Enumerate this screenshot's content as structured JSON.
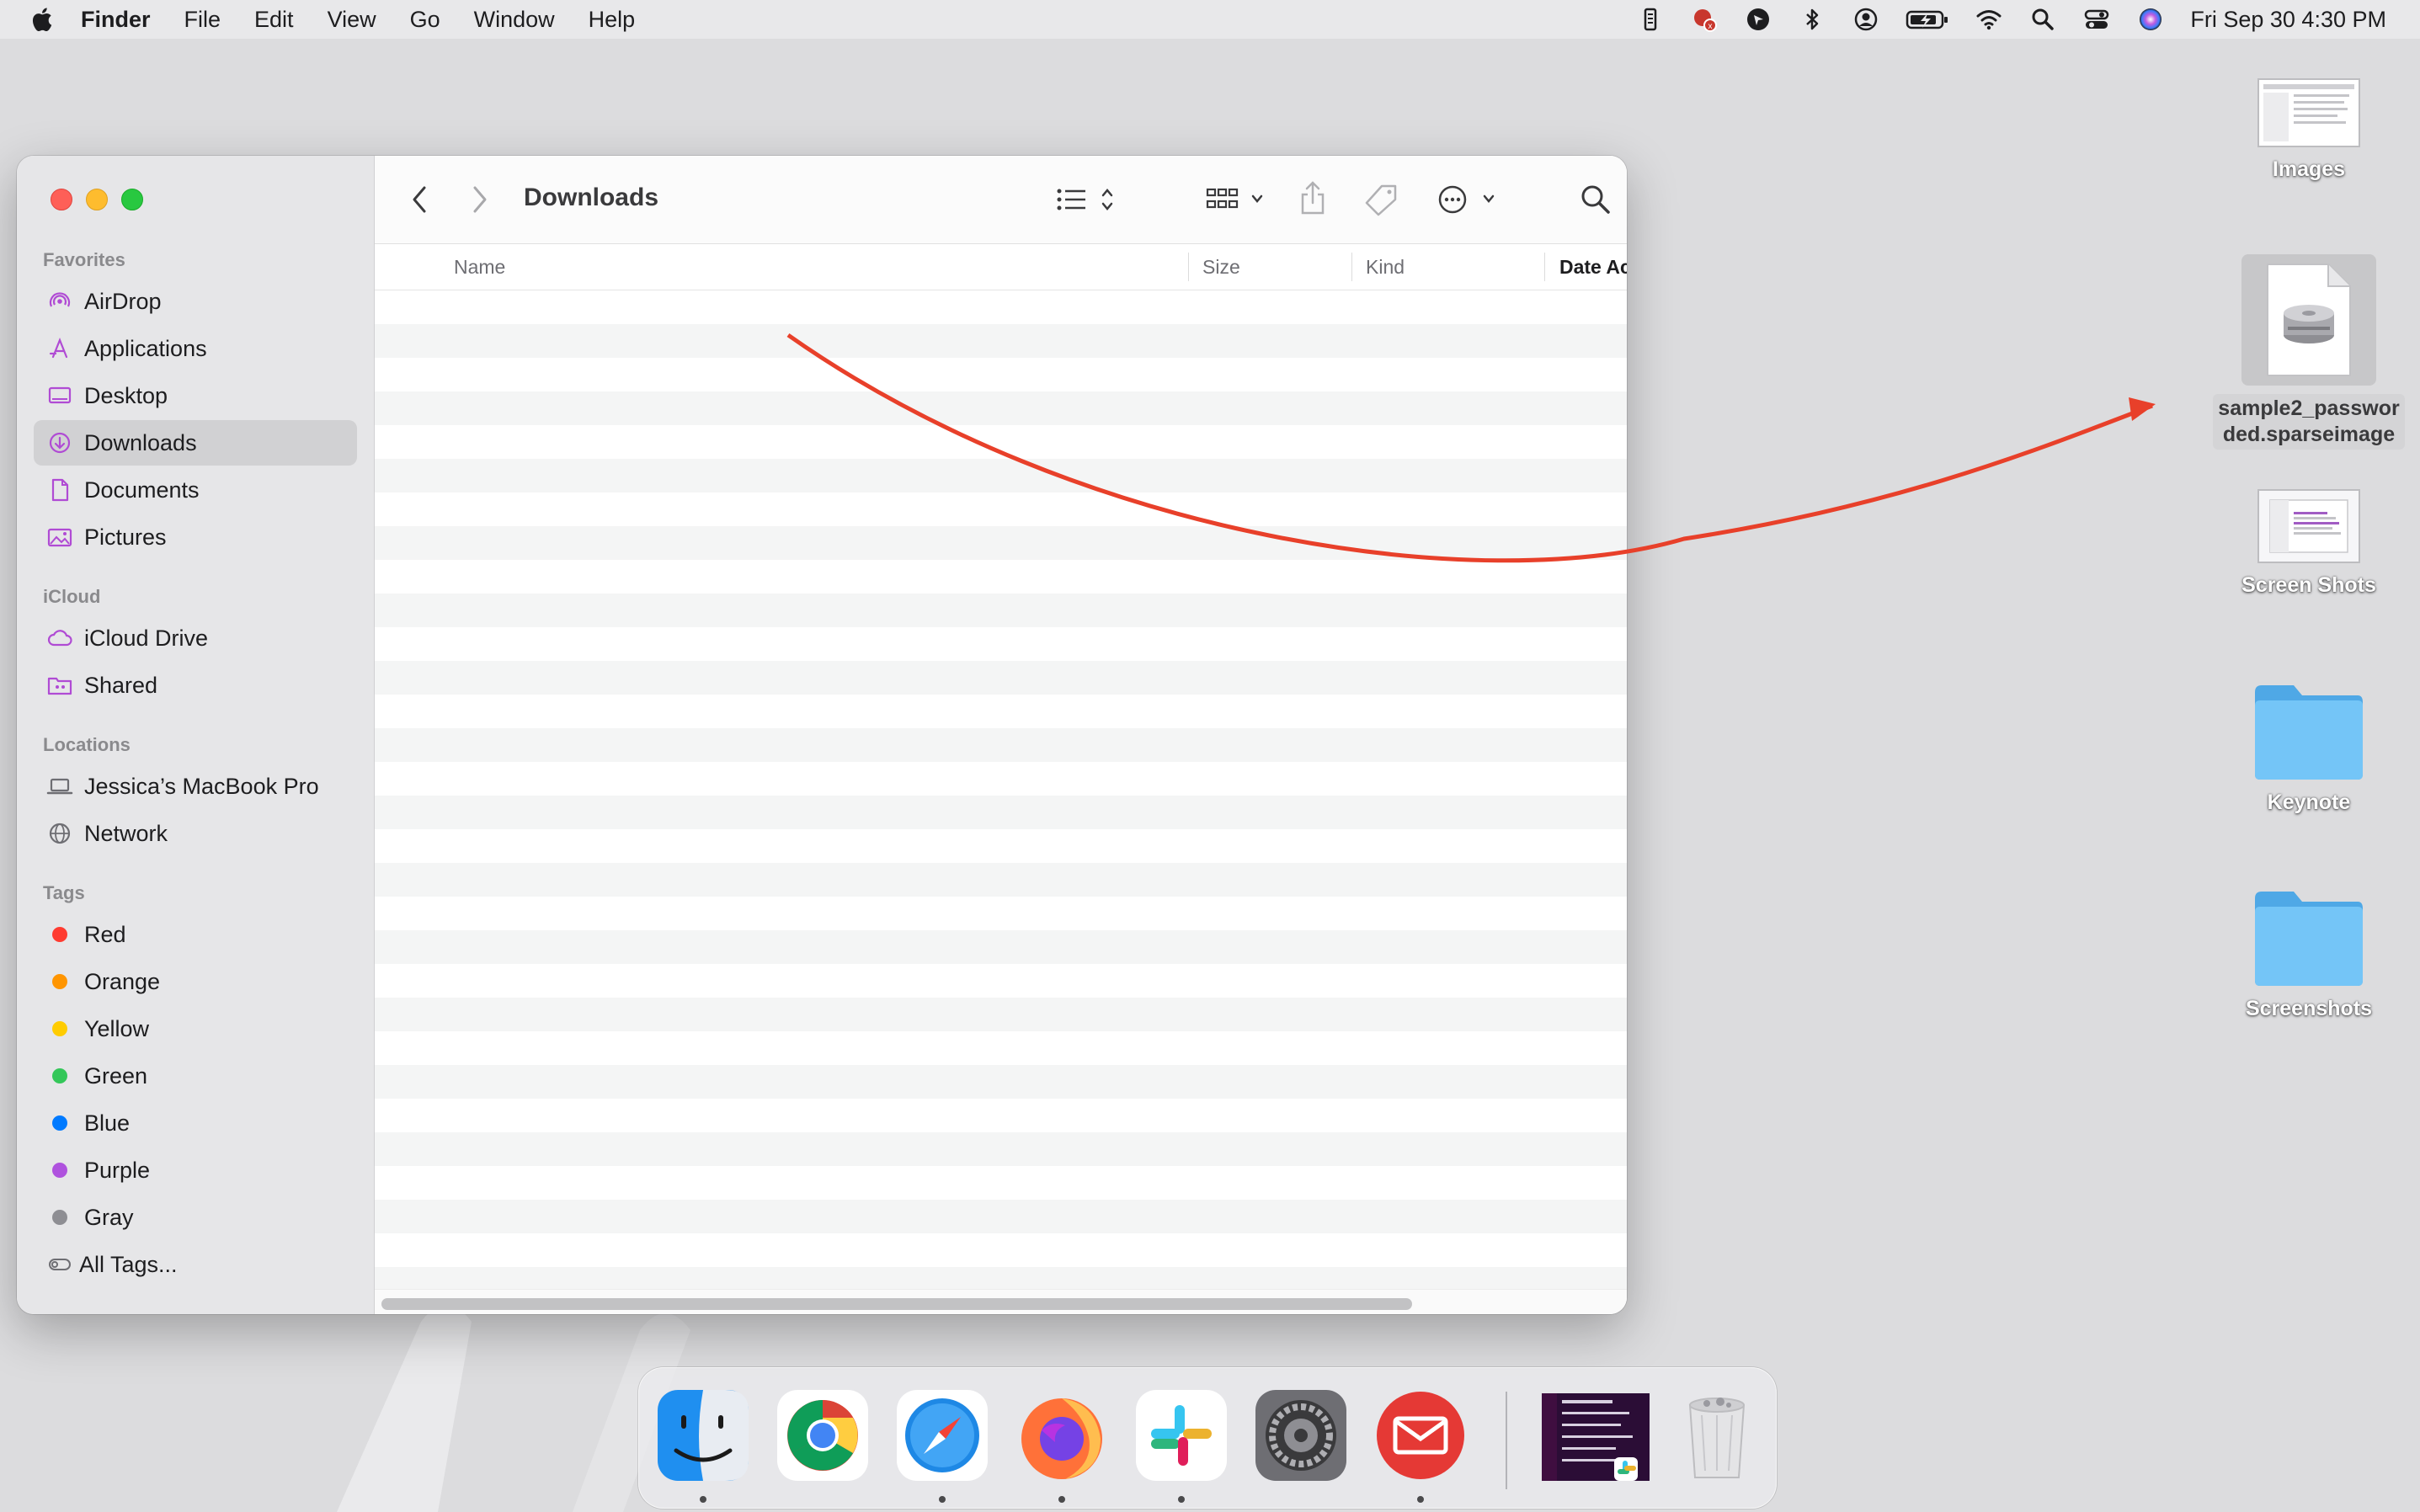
{
  "menubar": {
    "app_name": "Finder",
    "menus": [
      "File",
      "Edit",
      "View",
      "Go",
      "Window",
      "Help"
    ],
    "clock": "Fri Sep 30  4:30 PM"
  },
  "window": {
    "title": "Downloads",
    "sidebar": {
      "favorites_heading": "Favorites",
      "favorites": [
        "AirDrop",
        "Applications",
        "Desktop",
        "Downloads",
        "Documents",
        "Pictures"
      ],
      "selected": "Downloads",
      "icloud_heading": "iCloud",
      "icloud": [
        "iCloud Drive",
        "Shared"
      ],
      "locations_heading": "Locations",
      "locations": [
        "Jessica’s MacBook Pro",
        "Network"
      ],
      "tags_heading": "Tags",
      "tags": [
        {
          "label": "Red",
          "color": "#ff3b30"
        },
        {
          "label": "Orange",
          "color": "#ff9500"
        },
        {
          "label": "Yellow",
          "color": "#ffcc00"
        },
        {
          "label": "Green",
          "color": "#34c759"
        },
        {
          "label": "Blue",
          "color": "#007aff"
        },
        {
          "label": "Purple",
          "color": "#af52de"
        },
        {
          "label": "Gray",
          "color": "#8e8e93"
        },
        {
          "label": "All Tags..."
        }
      ]
    },
    "columns": [
      "Name",
      "Size",
      "Kind",
      "Date Ac"
    ]
  },
  "desktop": {
    "items": [
      "Images",
      "sample2_passworded.sparseimage",
      "Screen Shots",
      "Keynote",
      "Screenshots"
    ],
    "selected_item_label_lines": [
      "sample2_passwor",
      "ded.sparseimage"
    ]
  },
  "dock": {
    "apps": [
      "Finder",
      "Google Chrome",
      "Safari",
      "Firefox",
      "Slack",
      "System Preferences",
      "Mail",
      "Window preview",
      "Trash"
    ]
  },
  "colors": {
    "accent": "#e8402a",
    "folder_blue": "#6ec1f5"
  }
}
